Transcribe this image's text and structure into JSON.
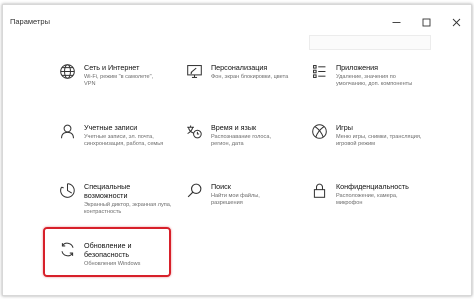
{
  "window": {
    "title": "Параметры",
    "minimize_symbol": "—",
    "maximize_symbol": "☐",
    "close_symbol": "✕"
  },
  "tiles": [
    {
      "title": "Сеть и Интернет",
      "desc": [
        "Wi-Fi, режим \"в самолете\",",
        "VPN"
      ],
      "icon": "globe-icon"
    },
    {
      "title": "Персонализация",
      "desc": [
        "Фон, экран блокировки, цвета"
      ],
      "icon": "paint-monitor-icon"
    },
    {
      "title": "Приложения",
      "desc": [
        "Удаление, значения по",
        "умолчанию, доп. компоненты"
      ],
      "icon": "apps-list-icon"
    },
    {
      "title": "Учетные записи",
      "desc": [
        "Учетные записи, эл. почта,",
        "синхронизация, работа, семья"
      ],
      "icon": "person-icon"
    },
    {
      "title": "Время и язык",
      "desc": [
        "Распознавание голоса,",
        "регион, дата"
      ],
      "icon": "time-language-icon"
    },
    {
      "title": "Игры",
      "desc": [
        "Меню игры, снимки, трансляция,",
        "игровой режим"
      ],
      "icon": "xbox-icon"
    },
    {
      "title": "Специальные",
      "title2": "возможности",
      "desc": [
        "Экранный диктор, экранная лупа,",
        "контрастность"
      ],
      "icon": "ease-of-access-icon"
    },
    {
      "title": "Поиск",
      "desc": [
        "Найти мои файлы,",
        "разрешения"
      ],
      "icon": "search-icon"
    },
    {
      "title": "Конфиденциальность",
      "desc": [
        "Расположение, камера,",
        "микрофон"
      ],
      "icon": "lock-icon"
    },
    {
      "title": "Обновление и",
      "title2": "безопасность",
      "desc": [
        "Обновления Windows"
      ],
      "icon": "update-icon"
    }
  ],
  "colors": {
    "highlight": "#d7202a"
  }
}
